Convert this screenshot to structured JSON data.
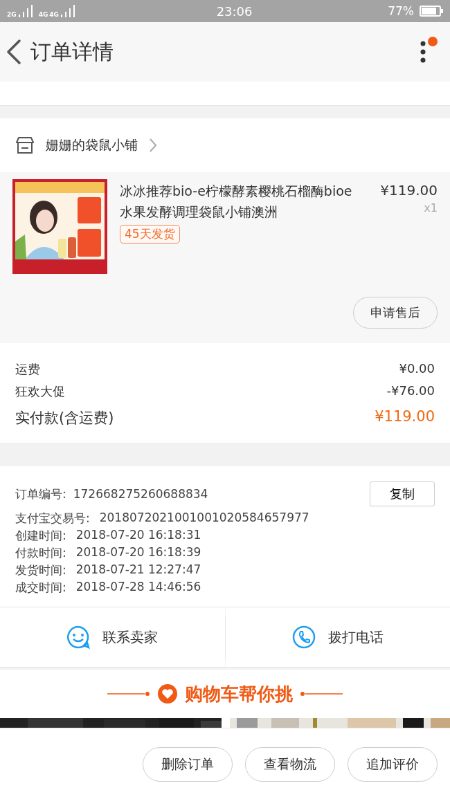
{
  "status_bar": {
    "network_1": "2G",
    "network_2": "4G",
    "network_3": "4G",
    "time": "23:06",
    "battery": "77%"
  },
  "header": {
    "title": "订单详情",
    "notification_dot": true
  },
  "shop": {
    "name": "姗姗的袋鼠小铺"
  },
  "product": {
    "kind": "picture",
    "title": "冰冰推荐bio-e柠檬酵素樱桃石榴酶bioe水果发酵调理袋鼠小铺澳洲",
    "price": "¥119.00",
    "quantity": "x1",
    "tag": "45天发货",
    "button": "申请售后"
  },
  "fees": [
    {
      "label": "运费",
      "value": "¥0.00",
      "kind": "normal"
    },
    {
      "label": "狂欢大促",
      "value": "-¥76.00",
      "kind": "normal"
    },
    {
      "label": "实付款(含运费)",
      "value": "¥119.00",
      "kind": "total"
    }
  ],
  "order_info": {
    "order_number_label": "订单编号:",
    "order_number": "172668275260688834",
    "copy_button": "复制",
    "rows": [
      {
        "label": "支付宝交易号:",
        "value": "2018072021001001020584657977"
      },
      {
        "label": "创建时间:",
        "value": "2018-07-20 16:18:31"
      },
      {
        "label": "付款时间:",
        "value": "2018-07-20 16:18:39"
      },
      {
        "label": "发货时间:",
        "value": "2018-07-21 12:27:47"
      },
      {
        "label": "成交时间:",
        "value": "2018-07-28 14:46:56"
      }
    ]
  },
  "contact": [
    {
      "kind": "chat",
      "label": "联系卖家"
    },
    {
      "kind": "phone",
      "label": "拨打电话"
    }
  ],
  "recommend": {
    "title": "购物车帮你挑"
  },
  "actions": [
    "删除订单",
    "查看物流",
    "追加评价"
  ]
}
